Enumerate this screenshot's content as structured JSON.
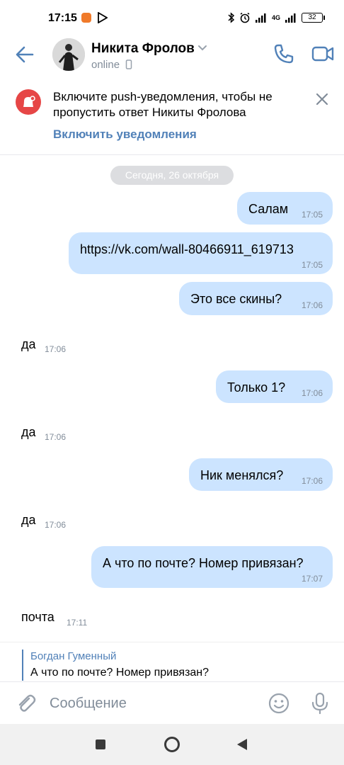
{
  "status_bar": {
    "time": "17:15",
    "network": "4G",
    "battery": "32"
  },
  "header": {
    "name": "Никита Фролов",
    "status": "online"
  },
  "banner": {
    "text": "Включите push-уведомления, чтобы не пропустить ответ Никиты Фролова",
    "action": "Включить уведомления"
  },
  "chat": {
    "date": "Сегодня, 26 октября",
    "messages": [
      {
        "dir": "out",
        "text": "Салам",
        "time": "17:05"
      },
      {
        "dir": "out",
        "text": "https://vk.com/wall-80466911_619713",
        "time": "17:05"
      },
      {
        "dir": "out",
        "text": "Это все скины?",
        "time": "17:06"
      },
      {
        "dir": "in",
        "text": "да",
        "time": "17:06"
      },
      {
        "dir": "out",
        "text": "Только 1?",
        "time": "17:06"
      },
      {
        "dir": "in",
        "text": "да",
        "time": "17:06"
      },
      {
        "dir": "out",
        "text": "Ник менялся?",
        "time": "17:06"
      },
      {
        "dir": "in",
        "text": "да",
        "time": "17:06"
      },
      {
        "dir": "out",
        "text": "А что по почте? Номер привязан?",
        "time": "17:07"
      },
      {
        "dir": "in",
        "text": "почта",
        "time": "17:11"
      }
    ]
  },
  "reply": {
    "author": "Богдан Гуменный",
    "text": "А что по почте? Номер привязан?"
  },
  "composer": {
    "placeholder": "Сообщение"
  },
  "colors": {
    "accent": "#5181b8",
    "bubble_out": "#cce4ff",
    "notify": "#e64646"
  }
}
